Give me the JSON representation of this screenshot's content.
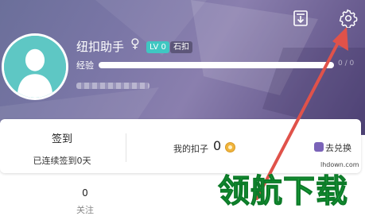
{
  "header": {
    "icons": [
      "download-icon",
      "settings-icon"
    ],
    "background_color": "#7a76a6"
  },
  "profile": {
    "username": "纽扣助手",
    "gender_symbol": "♀",
    "level_badge": "LV 0",
    "rank_badge": "石扣",
    "exp_label": "经验",
    "exp_value": "0 / 0",
    "exp_progress": 0,
    "avatar_color": "#5ec7c4"
  },
  "card": {
    "checkin_title": "签到",
    "checkin_subtitle": "已连续签到0天",
    "coins_label": "我的扣子",
    "coins_value": "0",
    "exchange_label": "去兑换"
  },
  "stats": {
    "follow_count": "0",
    "follow_label": "关注"
  },
  "watermark": {
    "logo_text": "领航下载",
    "site_text": "lhdown.com",
    "color": "#1aa53b"
  },
  "annotation": {
    "arrow_color": "#e0524a"
  }
}
